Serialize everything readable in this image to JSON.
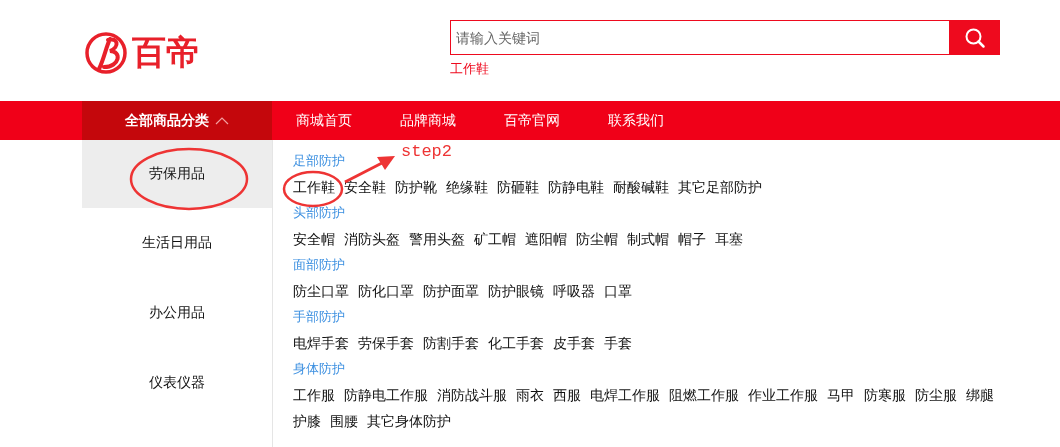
{
  "logo": {
    "text": "百帝"
  },
  "search": {
    "placeholder": "请输入关键词",
    "hot_keywords": [
      "工作鞋"
    ]
  },
  "nav": {
    "category_button": {
      "label": "全部商品分类",
      "expanded": true
    },
    "links": [
      "商城首页",
      "品牌商城",
      "百帝官网",
      "联系我们"
    ]
  },
  "sidebar": {
    "items": [
      {
        "label": "劳保用品",
        "selected": true
      },
      {
        "label": "生活日用品",
        "selected": false
      },
      {
        "label": "办公用品",
        "selected": false
      },
      {
        "label": "仪表仪器",
        "selected": false
      }
    ]
  },
  "categories": [
    {
      "title": "足部防护",
      "items": [
        "工作鞋",
        "安全鞋",
        "防护靴",
        "绝缘鞋",
        "防砸鞋",
        "防静电鞋",
        "耐酸碱鞋",
        "其它足部防护"
      ]
    },
    {
      "title": "头部防护",
      "items": [
        "安全帽",
        "消防头盔",
        "警用头盔",
        "矿工帽",
        "遮阳帽",
        "防尘帽",
        "制式帽",
        "帽子",
        "耳塞"
      ]
    },
    {
      "title": "面部防护",
      "items": [
        "防尘口罩",
        "防化口罩",
        "防护面罩",
        "防护眼镜",
        "呼吸器",
        "口罩"
      ]
    },
    {
      "title": "手部防护",
      "items": [
        "电焊手套",
        "劳保手套",
        "防割手套",
        "化工手套",
        "皮手套",
        "手套"
      ]
    },
    {
      "title": "身体防护",
      "items": [
        "工作服",
        "防静电工作服",
        "消防战斗服",
        "雨衣",
        "西服",
        "电焊工作服",
        "阻燃工作服",
        "作业工作服",
        "马甲",
        "防寒服",
        "防尘服",
        "绑腿",
        "护膝",
        "围腰",
        "其它身体防护"
      ]
    }
  ],
  "annotation": {
    "label": "step2"
  }
}
